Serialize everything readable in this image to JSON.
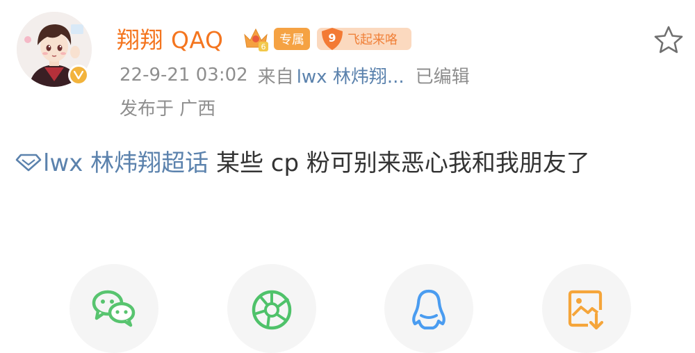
{
  "post": {
    "author": {
      "name": "翔翔 QAQ",
      "avatar_icon": "anime-avatar",
      "verified_icon": "verified-v-icon",
      "crown_icon": "vip-crown-icon",
      "crown_level": "6",
      "badges": [
        "专属"
      ],
      "fans_badge": {
        "level": "9",
        "label": "飞起来咯"
      }
    },
    "meta": {
      "date": "22-9-21 03:02",
      "source_prefix": "来自",
      "source_name": "lwx 林炜翔...",
      "edited": "已编辑",
      "location": "发布于 广西"
    },
    "content": {
      "topic": "lwx 林炜翔超话",
      "text": "某些 cp 粉可别来恶心我和我朋友了"
    },
    "favorite_icon": "star-outline-icon"
  },
  "share": {
    "buttons": [
      {
        "icon": "wechat-icon"
      },
      {
        "icon": "moments-icon"
      },
      {
        "icon": "qq-icon"
      },
      {
        "icon": "save-image-icon"
      }
    ]
  },
  "colors": {
    "username": "#f4751f",
    "link": "#5b82ad",
    "meta": "#8e8e8e",
    "body": "#333333",
    "wechat": "#58c46f",
    "moments": "#4fc26a",
    "qq": "#4a9cf0",
    "save": "#f5a53a"
  }
}
